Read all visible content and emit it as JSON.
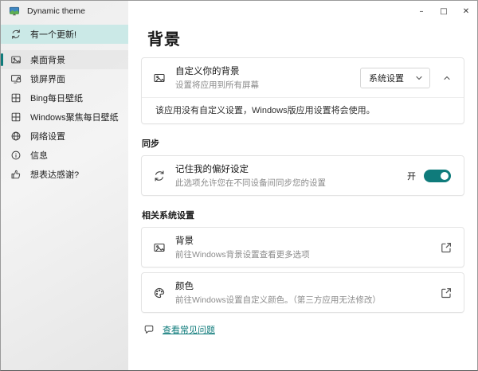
{
  "window": {
    "title": "Dynamic theme",
    "controls": {
      "minimize": "–",
      "maximize": "□",
      "close": "✕"
    }
  },
  "colors": {
    "accent": "#0f7b7b",
    "banner": "#cbe9e7",
    "link": "#0f7b7b"
  },
  "sidebar": {
    "update": {
      "label": "有一个更新!",
      "icon": "refresh-icon"
    },
    "items": [
      {
        "label": "桌面背景",
        "icon": "image-icon",
        "selected": true
      },
      {
        "label": "锁屏界面",
        "icon": "lockscreen-icon",
        "selected": false
      },
      {
        "label": "Bing每日壁纸",
        "icon": "grid-icon",
        "selected": false
      },
      {
        "label": "Windows聚焦每日壁纸",
        "icon": "grid-icon",
        "selected": false
      },
      {
        "label": "网络设置",
        "icon": "globe-icon",
        "selected": false
      },
      {
        "label": "信息",
        "icon": "info-icon",
        "selected": false
      },
      {
        "label": "想表达感谢?",
        "icon": "thumbs-up-icon",
        "selected": false
      }
    ]
  },
  "main": {
    "title": "背景",
    "customize_card": {
      "title": "自定义你的背景",
      "subtitle": "设置将应用到所有屏幕",
      "dropdown_value": "系统设置",
      "expanded_message": "该应用没有自定义设置，Windows版应用设置将会使用。"
    },
    "sync_section": {
      "header": "同步",
      "card": {
        "title": "记住我的偏好设定",
        "subtitle": "此选项允许您在不同设备间同步您的设置",
        "toggle_label": "开",
        "toggle_state": "on"
      }
    },
    "related_section": {
      "header": "相关系统设置",
      "cards": [
        {
          "title": "背景",
          "subtitle": "前往Windows背景设置查看更多选项"
        },
        {
          "title": "颜色",
          "subtitle": "前往Windows设置自定义颜色。（第三方应用无法修改）"
        }
      ]
    },
    "faq_link": "查看常见问题"
  }
}
